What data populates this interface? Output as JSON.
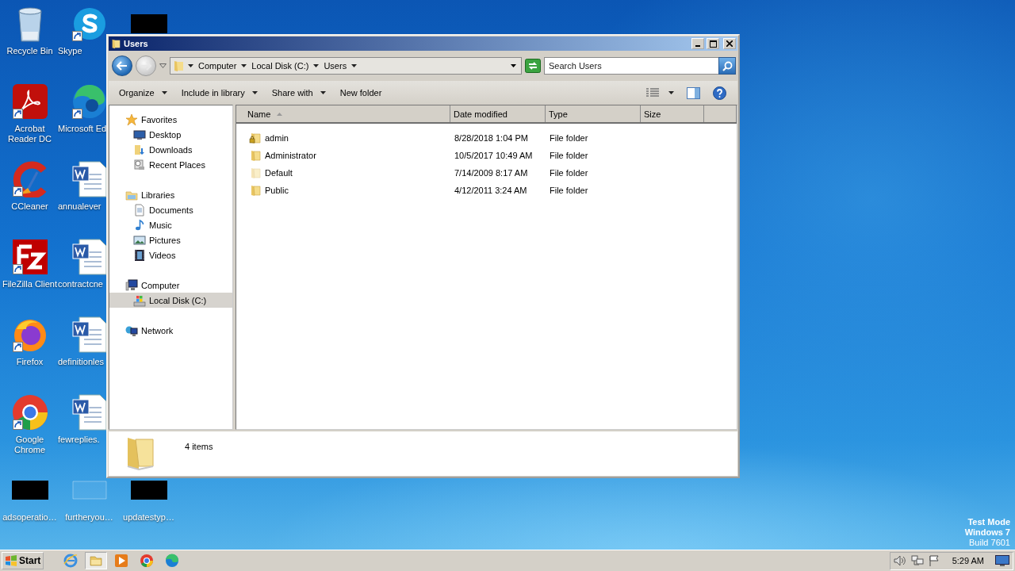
{
  "desktop": {
    "columns": [
      {
        "icons": [
          {
            "label": "Recycle Bin",
            "kind": "recycle",
            "shortcut": false
          },
          {
            "label": "Acrobat Reader DC",
            "kind": "acrobat",
            "shortcut": true
          },
          {
            "label": "CCleaner",
            "kind": "ccleaner",
            "shortcut": true
          },
          {
            "label": "FileZilla Client",
            "kind": "filezilla",
            "shortcut": true
          },
          {
            "label": "Firefox",
            "kind": "firefox",
            "shortcut": true
          },
          {
            "label": "Google Chrome",
            "kind": "chrome",
            "shortcut": true
          },
          {
            "label": "adsoperatio…",
            "kind": "redacted",
            "shortcut": false
          }
        ]
      },
      {
        "icons": [
          {
            "label": "Skype",
            "kind": "skype",
            "shortcut": true
          },
          {
            "label": "Microsoft Ed",
            "kind": "edge",
            "shortcut": true
          },
          {
            "label": "annualever",
            "kind": "word",
            "shortcut": false
          },
          {
            "label": "contractcne",
            "kind": "word",
            "shortcut": false
          },
          {
            "label": "definitionles",
            "kind": "word",
            "shortcut": false
          },
          {
            "label": "fewreplies.",
            "kind": "word",
            "shortcut": false
          },
          {
            "label": "furtheryou…",
            "kind": "faint",
            "shortcut": false
          }
        ]
      },
      {
        "icons": [
          {
            "kind": "redacted",
            "shortcut": false
          },
          {
            "label": "updatestyp…",
            "kind": "redacted",
            "shortcut": false
          }
        ]
      }
    ]
  },
  "system_notice": [
    "Test Mode",
    "Windows 7",
    "Build 7601"
  ],
  "window": {
    "title": "Users",
    "breadcrumbs": [
      "Computer",
      "Local Disk (C:)",
      "Users"
    ],
    "search": {
      "placeholder": "Search Users"
    },
    "toolbar": [
      {
        "label": "Organize",
        "dropdown": true
      },
      {
        "label": "Include in library",
        "dropdown": true
      },
      {
        "label": "Share with",
        "dropdown": true
      },
      {
        "label": "New folder",
        "dropdown": false
      }
    ],
    "tree": [
      {
        "label": "Favorites",
        "selected": false,
        "children": [
          {
            "label": "Desktop",
            "selected": false
          },
          {
            "label": "Downloads",
            "selected": false
          },
          {
            "label": "Recent Places",
            "selected": false
          }
        ]
      },
      {
        "label": "Libraries",
        "selected": false,
        "children": [
          {
            "label": "Documents",
            "selected": false
          },
          {
            "label": "Music",
            "selected": false
          },
          {
            "label": "Pictures",
            "selected": false
          },
          {
            "label": "Videos",
            "selected": false
          }
        ]
      },
      {
        "label": "Computer",
        "selected": false,
        "children": [
          {
            "label": "Local Disk (C:)",
            "selected": true
          }
        ]
      },
      {
        "label": "Network",
        "selected": false
      }
    ],
    "columns": [
      {
        "label": "Name",
        "sorted": true
      },
      {
        "label": "Date modified",
        "sorted": false
      },
      {
        "label": "Type",
        "sorted": false
      },
      {
        "label": "Size",
        "sorted": false
      }
    ],
    "rows": [
      {
        "name": "admin",
        "locked": true,
        "hidden": false,
        "date": "8/28/2018 1:04 PM",
        "type": "File folder"
      },
      {
        "name": "Administrator",
        "locked": false,
        "hidden": false,
        "date": "10/5/2017 10:49 AM",
        "type": "File folder"
      },
      {
        "name": "Default",
        "locked": false,
        "hidden": true,
        "date": "7/14/2009 8:17 AM",
        "type": "File folder"
      },
      {
        "name": "Public",
        "locked": false,
        "hidden": false,
        "date": "4/12/2011 3:24 AM",
        "type": "File folder"
      }
    ],
    "details": {
      "summary": "4 items"
    }
  },
  "taskbar": {
    "start": "Start",
    "apps": [
      {
        "kind": "ie",
        "active": false
      },
      {
        "kind": "explorer",
        "active": true
      },
      {
        "kind": "media",
        "active": false
      },
      {
        "kind": "chrome",
        "active": false
      },
      {
        "kind": "edge",
        "active": false
      }
    ],
    "clock": "5:29 AM"
  }
}
